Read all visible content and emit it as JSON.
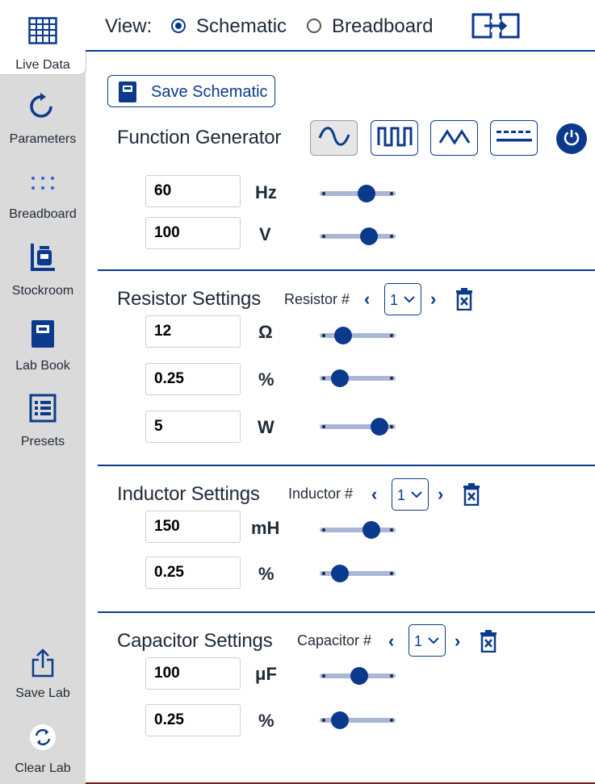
{
  "sidebar": {
    "items": [
      {
        "label": "Live Data",
        "icon": "table-icon"
      },
      {
        "label": "Parameters",
        "icon": "refresh-icon"
      },
      {
        "label": "Breadboard",
        "icon": "dots-grid-icon"
      },
      {
        "label": "Stockroom",
        "icon": "jar-icon"
      },
      {
        "label": "Lab Book",
        "icon": "book-icon"
      },
      {
        "label": "Presets",
        "icon": "list-icon"
      },
      {
        "label": "Save Lab",
        "icon": "share-icon"
      },
      {
        "label": "Clear Lab",
        "icon": "clear-icon"
      }
    ]
  },
  "topbar": {
    "view_label": "View:",
    "options": [
      "Schematic",
      "Breadboard"
    ],
    "selected": "Schematic"
  },
  "save_schematic": {
    "label": "Save Schematic"
  },
  "function_generator": {
    "title": "Function Generator",
    "waveforms": [
      "sine-wave-icon",
      "square-wave-icon",
      "triangle-wave-icon",
      "dc-icon"
    ],
    "selected_waveform": "sine-wave-icon",
    "frequency": {
      "value": "60",
      "unit": "Hz",
      "level": 0.65
    },
    "voltage": {
      "value": "100",
      "unit": "V",
      "level": 0.7
    }
  },
  "resistor": {
    "title": "Resistor Settings",
    "number_label": "Resistor #",
    "selected": "1",
    "resistance": {
      "value": "12",
      "unit": "Ω",
      "level": 0.25
    },
    "tolerance": {
      "value": "0.25",
      "unit": "%",
      "level": 0.2
    },
    "power": {
      "value": "5",
      "unit": "W",
      "level": 0.88
    }
  },
  "inductor": {
    "title": "Inductor Settings",
    "number_label": "Inductor #",
    "selected": "1",
    "inductance": {
      "value": "150",
      "unit": "mH",
      "level": 0.73
    },
    "tolerance": {
      "value": "0.25",
      "unit": "%",
      "level": 0.2
    }
  },
  "capacitor": {
    "title": "Capacitor Settings",
    "number_label": "Capacitor #",
    "selected": "1",
    "capacitance": {
      "value": "100",
      "unit": "μF",
      "level": 0.53
    },
    "tolerance": {
      "value": "0.25",
      "unit": "%",
      "level": 0.2
    }
  },
  "colors": {
    "accent": "#0b3a8c",
    "sidebar": "#dadada",
    "track": "#a9b6d6"
  }
}
